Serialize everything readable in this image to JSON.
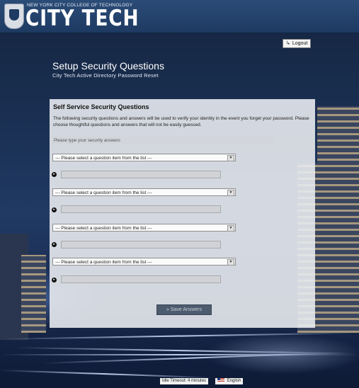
{
  "header": {
    "college_line": "NEW YORK CITY COLLEGE OF TECHNOLOGY",
    "brand": "CITY TECH",
    "logout_label": "Logout",
    "logout_icon": "logout-icon"
  },
  "page": {
    "title": "Setup Security Questions",
    "subtitle": "City Tech Active Directory Password Reset"
  },
  "panel": {
    "title": "Self Service Security Questions",
    "description": "The following security questions and answers will be used to verify your identity in the event you forget your password. Please choose thoughtful questions and answers that will not be easily guessed.",
    "hint": "Please type your security answers",
    "questions": [
      {
        "selected": "--- Please select a question item from the list ---",
        "answer": ""
      },
      {
        "selected": "--- Please select a question item from the list ---",
        "answer": ""
      },
      {
        "selected": "--- Please select a question item from the list ---",
        "answer": ""
      },
      {
        "selected": "--- Please select a question item from the list ---",
        "answer": ""
      }
    ],
    "save_label": "Save Answers",
    "save_icon": "double-chevron-right-icon"
  },
  "footer": {
    "idle_timeout": "Idle Timeout: 4 minutes",
    "language": "English"
  },
  "colors": {
    "header_bg": "#1d3a62",
    "button_bg": "#4d5b6e"
  }
}
